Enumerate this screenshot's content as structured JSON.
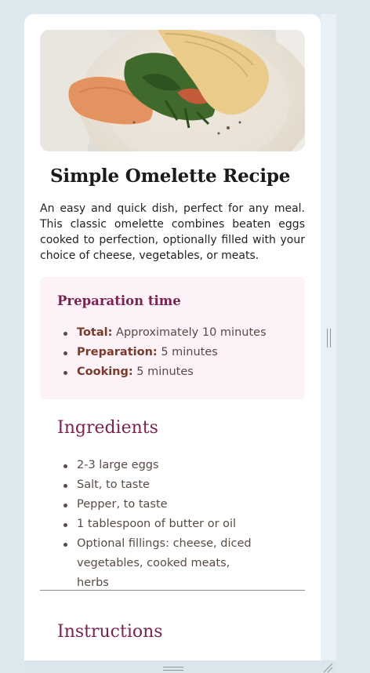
{
  "recipe": {
    "title": "Simple Omelette Recipe",
    "description": "An easy and quick dish, perfect for any meal. This classic omelette combines beaten eggs cooked to perfection, optionally filled with your choice of cheese, vegetables, or meats.",
    "image_icon": "omelette-photo"
  },
  "preparation": {
    "heading": "Preparation time",
    "items": [
      {
        "label": "Total:",
        "value": "Approximately 10 minutes"
      },
      {
        "label": "Preparation:",
        "value": "5 minutes"
      },
      {
        "label": "Cooking:",
        "value": "5 minutes"
      }
    ]
  },
  "ingredients": {
    "heading": "Ingredients",
    "items": [
      "2-3 large eggs",
      "Salt, to taste",
      "Pepper, to taste",
      "1 tablespoon of butter or oil",
      "Optional fillings: cheese, diced vegetables, cooked meats, herbs"
    ]
  },
  "instructions": {
    "heading": "Instructions"
  },
  "colors": {
    "page_bg": "#dde8ef",
    "card_bg": "#ffffff",
    "accent": "#7a2350",
    "prep_bg": "#fdf2f7",
    "label_brown": "#7a3a2a"
  }
}
